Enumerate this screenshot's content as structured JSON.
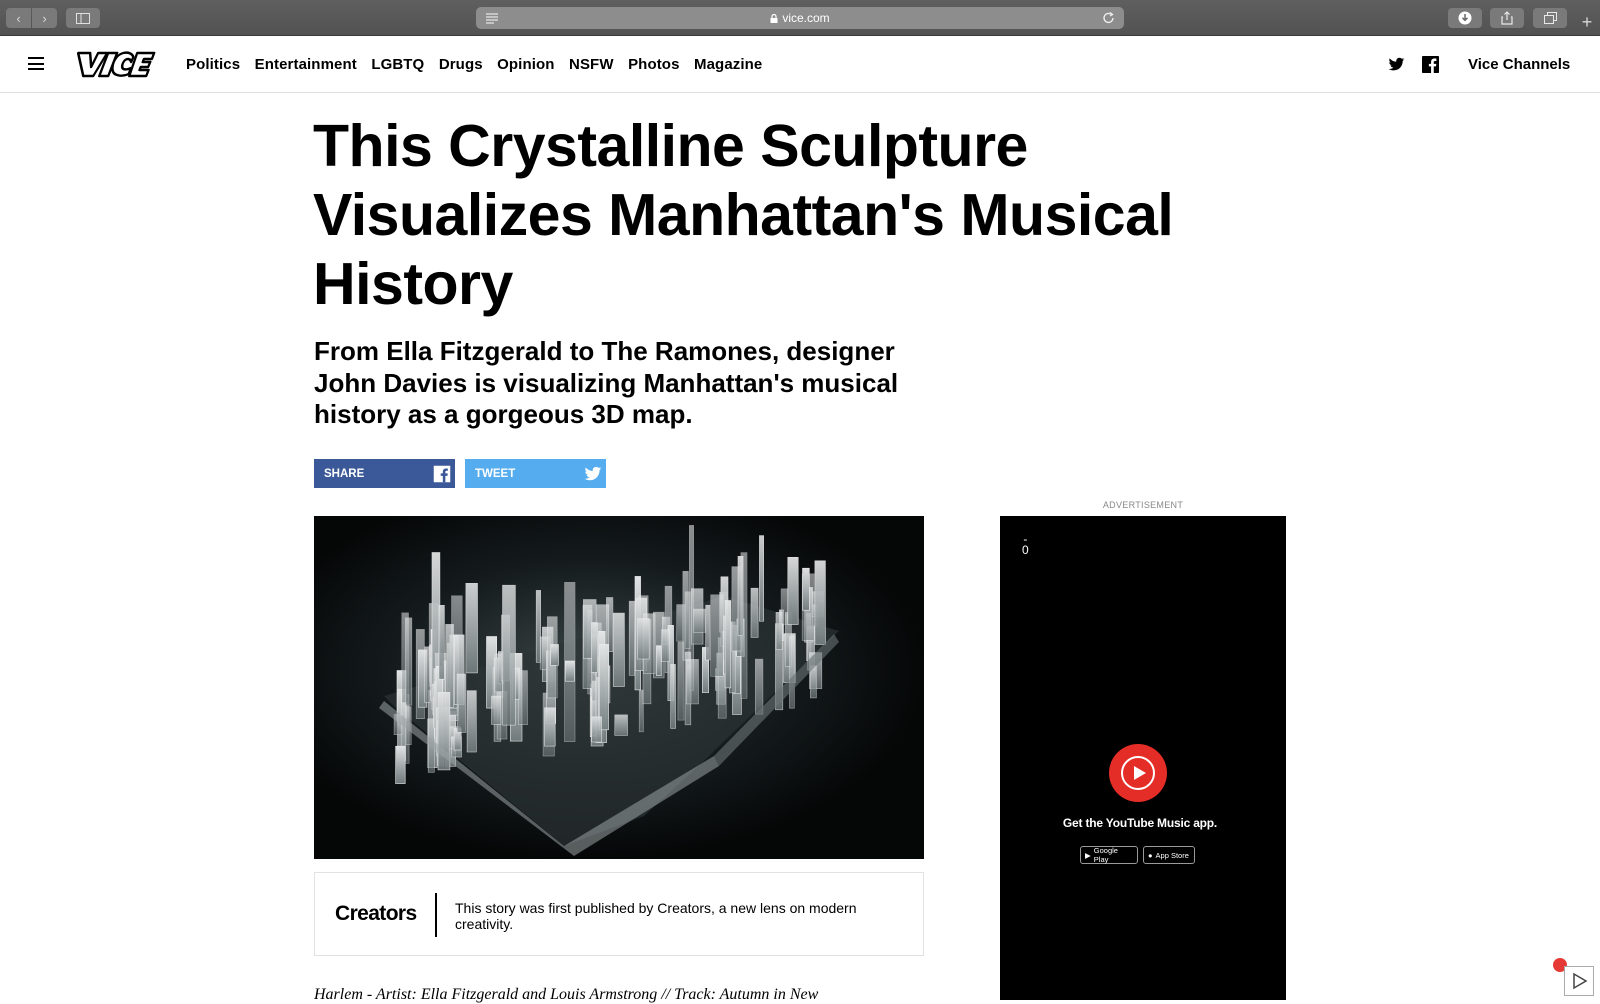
{
  "browser": {
    "url": "vice.com"
  },
  "nav": {
    "items": [
      "Politics",
      "Entertainment",
      "LGBTQ",
      "Drugs",
      "Opinion",
      "NSFW",
      "Photos",
      "Magazine"
    ],
    "channels_label": "Vice Channels"
  },
  "article": {
    "title": "This Crystalline Sculpture Visualizes Manhattan's Musical History",
    "dek": "From Ella Fitzgerald to The Ramones, designer John Davies is visualizing Manhattan's musical history as a gorgeous 3D map.",
    "share_label": "SHARE",
    "tweet_label": "TWEET",
    "creators_logo": "Creators",
    "creators_text": "This story was first published by Creators, a new lens on modern creativity.",
    "caption": "Harlem - Artist: Ella Fitzgerald and Louis Armstrong // Track: Autumn in New"
  },
  "ad": {
    "label": "ADVERTISEMENT",
    "counter": "0",
    "text": "Get the YouTube Music app.",
    "google_play": "Google Play",
    "app_store": "App Store"
  },
  "colors": {
    "facebook": "#3b5998",
    "twitter": "#55acee",
    "youtube": "#e52d27"
  }
}
